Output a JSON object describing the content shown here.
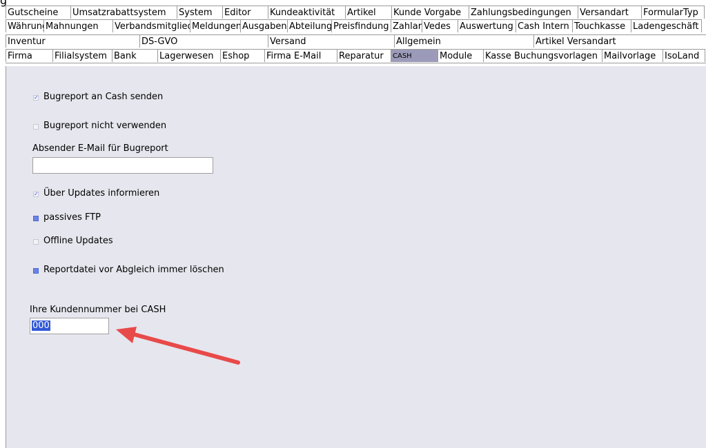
{
  "tab_rows": [
    [
      "Gutscheine",
      "Umsatzrabattsystem",
      "System",
      "Editor",
      "Kundeaktivität",
      "Artikel",
      "Kunde Vorgabe",
      "Zahlungsbedingungen",
      "Versandart",
      "FormularTyp"
    ],
    [
      "Währung",
      "Mahnungen",
      "Verbandsmitglied",
      "Meldungen",
      "Ausgaben",
      "Abteilung",
      "Preisfindung",
      "Zahlart",
      "Vedes",
      "Auswertung",
      "Cash Intern",
      "Touchkasse",
      "Ladengeschäft"
    ],
    [
      "Inventur",
      "DS-GVO",
      "Versand",
      "Allgemein",
      "Artikel Versandart"
    ],
    [
      "Firma",
      "Filialsystem",
      "Bank",
      "Lagerwesen",
      "Eshop",
      "Firma E-Mail",
      "Reparatur",
      "CASH",
      "Module",
      "Kasse Buchungsvorlagen",
      "Mailvorlage",
      "IsoLand"
    ]
  ],
  "active_tab": "CASH",
  "top_glyph": "g",
  "form": {
    "bugreport_cash": {
      "label": "Bugreport an Cash senden",
      "checked": true
    },
    "bugreport_none": {
      "label": "Bugreport nicht verwenden",
      "checked": false
    },
    "sender_email": {
      "label": "Absender E-Mail für Bugreport",
      "value": ""
    },
    "updates_info": {
      "label": "Über Updates informieren",
      "checked": true
    },
    "passive_ftp": {
      "label": "passives FTP",
      "checked": true
    },
    "offline_updates": {
      "label": "Offline Updates",
      "checked": false
    },
    "report_delete": {
      "label": "Reportdatei vor Abgleich immer löschen",
      "checked": true
    },
    "customer_number": {
      "label": "Ihre Kundennummer bei CASH",
      "value": "000"
    }
  },
  "colors": {
    "active_tab": "#9b9bb9",
    "panel": "#e6e6ee",
    "arrow": "#e84a4a",
    "selection": "#3358d6"
  }
}
